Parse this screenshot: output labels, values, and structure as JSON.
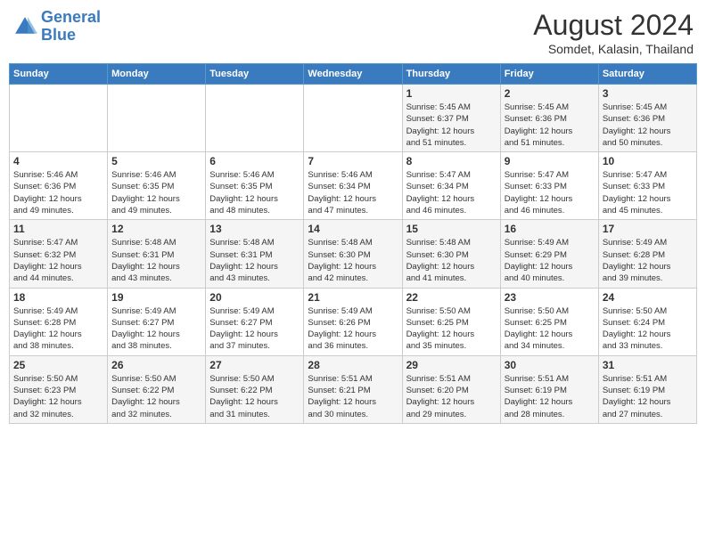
{
  "header": {
    "logo_line1": "General",
    "logo_line2": "Blue",
    "month_year": "August 2024",
    "location": "Somdet, Kalasin, Thailand"
  },
  "days_of_week": [
    "Sunday",
    "Monday",
    "Tuesday",
    "Wednesday",
    "Thursday",
    "Friday",
    "Saturday"
  ],
  "weeks": [
    [
      {
        "day": "",
        "info": ""
      },
      {
        "day": "",
        "info": ""
      },
      {
        "day": "",
        "info": ""
      },
      {
        "day": "",
        "info": ""
      },
      {
        "day": "1",
        "info": "Sunrise: 5:45 AM\nSunset: 6:37 PM\nDaylight: 12 hours\nand 51 minutes."
      },
      {
        "day": "2",
        "info": "Sunrise: 5:45 AM\nSunset: 6:36 PM\nDaylight: 12 hours\nand 51 minutes."
      },
      {
        "day": "3",
        "info": "Sunrise: 5:45 AM\nSunset: 6:36 PM\nDaylight: 12 hours\nand 50 minutes."
      }
    ],
    [
      {
        "day": "4",
        "info": "Sunrise: 5:46 AM\nSunset: 6:36 PM\nDaylight: 12 hours\nand 49 minutes."
      },
      {
        "day": "5",
        "info": "Sunrise: 5:46 AM\nSunset: 6:35 PM\nDaylight: 12 hours\nand 49 minutes."
      },
      {
        "day": "6",
        "info": "Sunrise: 5:46 AM\nSunset: 6:35 PM\nDaylight: 12 hours\nand 48 minutes."
      },
      {
        "day": "7",
        "info": "Sunrise: 5:46 AM\nSunset: 6:34 PM\nDaylight: 12 hours\nand 47 minutes."
      },
      {
        "day": "8",
        "info": "Sunrise: 5:47 AM\nSunset: 6:34 PM\nDaylight: 12 hours\nand 46 minutes."
      },
      {
        "day": "9",
        "info": "Sunrise: 5:47 AM\nSunset: 6:33 PM\nDaylight: 12 hours\nand 46 minutes."
      },
      {
        "day": "10",
        "info": "Sunrise: 5:47 AM\nSunset: 6:33 PM\nDaylight: 12 hours\nand 45 minutes."
      }
    ],
    [
      {
        "day": "11",
        "info": "Sunrise: 5:47 AM\nSunset: 6:32 PM\nDaylight: 12 hours\nand 44 minutes."
      },
      {
        "day": "12",
        "info": "Sunrise: 5:48 AM\nSunset: 6:31 PM\nDaylight: 12 hours\nand 43 minutes."
      },
      {
        "day": "13",
        "info": "Sunrise: 5:48 AM\nSunset: 6:31 PM\nDaylight: 12 hours\nand 43 minutes."
      },
      {
        "day": "14",
        "info": "Sunrise: 5:48 AM\nSunset: 6:30 PM\nDaylight: 12 hours\nand 42 minutes."
      },
      {
        "day": "15",
        "info": "Sunrise: 5:48 AM\nSunset: 6:30 PM\nDaylight: 12 hours\nand 41 minutes."
      },
      {
        "day": "16",
        "info": "Sunrise: 5:49 AM\nSunset: 6:29 PM\nDaylight: 12 hours\nand 40 minutes."
      },
      {
        "day": "17",
        "info": "Sunrise: 5:49 AM\nSunset: 6:28 PM\nDaylight: 12 hours\nand 39 minutes."
      }
    ],
    [
      {
        "day": "18",
        "info": "Sunrise: 5:49 AM\nSunset: 6:28 PM\nDaylight: 12 hours\nand 38 minutes."
      },
      {
        "day": "19",
        "info": "Sunrise: 5:49 AM\nSunset: 6:27 PM\nDaylight: 12 hours\nand 38 minutes."
      },
      {
        "day": "20",
        "info": "Sunrise: 5:49 AM\nSunset: 6:27 PM\nDaylight: 12 hours\nand 37 minutes."
      },
      {
        "day": "21",
        "info": "Sunrise: 5:49 AM\nSunset: 6:26 PM\nDaylight: 12 hours\nand 36 minutes."
      },
      {
        "day": "22",
        "info": "Sunrise: 5:50 AM\nSunset: 6:25 PM\nDaylight: 12 hours\nand 35 minutes."
      },
      {
        "day": "23",
        "info": "Sunrise: 5:50 AM\nSunset: 6:25 PM\nDaylight: 12 hours\nand 34 minutes."
      },
      {
        "day": "24",
        "info": "Sunrise: 5:50 AM\nSunset: 6:24 PM\nDaylight: 12 hours\nand 33 minutes."
      }
    ],
    [
      {
        "day": "25",
        "info": "Sunrise: 5:50 AM\nSunset: 6:23 PM\nDaylight: 12 hours\nand 32 minutes."
      },
      {
        "day": "26",
        "info": "Sunrise: 5:50 AM\nSunset: 6:22 PM\nDaylight: 12 hours\nand 32 minutes."
      },
      {
        "day": "27",
        "info": "Sunrise: 5:50 AM\nSunset: 6:22 PM\nDaylight: 12 hours\nand 31 minutes."
      },
      {
        "day": "28",
        "info": "Sunrise: 5:51 AM\nSunset: 6:21 PM\nDaylight: 12 hours\nand 30 minutes."
      },
      {
        "day": "29",
        "info": "Sunrise: 5:51 AM\nSunset: 6:20 PM\nDaylight: 12 hours\nand 29 minutes."
      },
      {
        "day": "30",
        "info": "Sunrise: 5:51 AM\nSunset: 6:19 PM\nDaylight: 12 hours\nand 28 minutes."
      },
      {
        "day": "31",
        "info": "Sunrise: 5:51 AM\nSunset: 6:19 PM\nDaylight: 12 hours\nand 27 minutes."
      }
    ]
  ]
}
